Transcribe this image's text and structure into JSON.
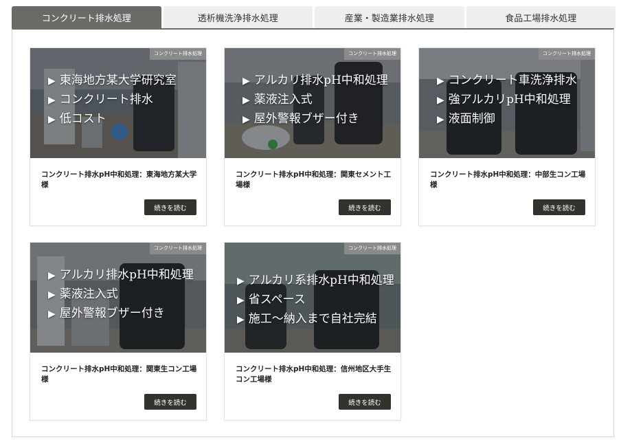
{
  "tabs": [
    {
      "label": "コンクリート排水処理",
      "active": true
    },
    {
      "label": "透析機洗浄排水処理",
      "active": false
    },
    {
      "label": "産業・製造業排水処理",
      "active": false
    },
    {
      "label": "食品工場排水処理",
      "active": false
    }
  ],
  "cards": [
    {
      "category": "コンクリート排水処理",
      "lines": [
        "東海地方某大学研究室",
        "コンクリート排水",
        "低コスト"
      ],
      "title": "コンクリート排水pH中和処理：東海地方某大学様",
      "button": "続きを読む"
    },
    {
      "category": "コンクリート排水処理",
      "lines": [
        "アルカリ排水pH中和処理",
        "薬液注入式",
        "屋外警報ブザー付き"
      ],
      "title": "コンクリート排水pH中和処理：関東セメント工場様",
      "button": "続きを読む"
    },
    {
      "category": "コンクリート排水処理",
      "lines": [
        "コンクリート車洗浄排水",
        "強アルカリpH中和処理",
        "液面制御"
      ],
      "title": "コンクリート排水pH中和処理：中部生コン工場様",
      "button": "続きを読む"
    },
    {
      "category": "コンクリート排水処理",
      "lines": [
        "アルカリ排水pH中和処理",
        "薬液注入式",
        "屋外警報ブザー付き"
      ],
      "title": "コンクリート排水pH中和処理：関東生コン工場様",
      "button": "続きを読む"
    },
    {
      "category": "コンクリート排水処理",
      "lines": [
        "アルカリ系排水pH中和処理",
        "省スペース",
        "施工～納入まで自社完結"
      ],
      "title": "コンクリート排水pH中和処理：信州地区大手生コン工場様",
      "button": "続きを読む"
    }
  ],
  "bullet_glyph": "▶",
  "colors": {
    "active_tab": "#6b6a66",
    "button": "#33322c",
    "badge": "#8a8a8a"
  }
}
